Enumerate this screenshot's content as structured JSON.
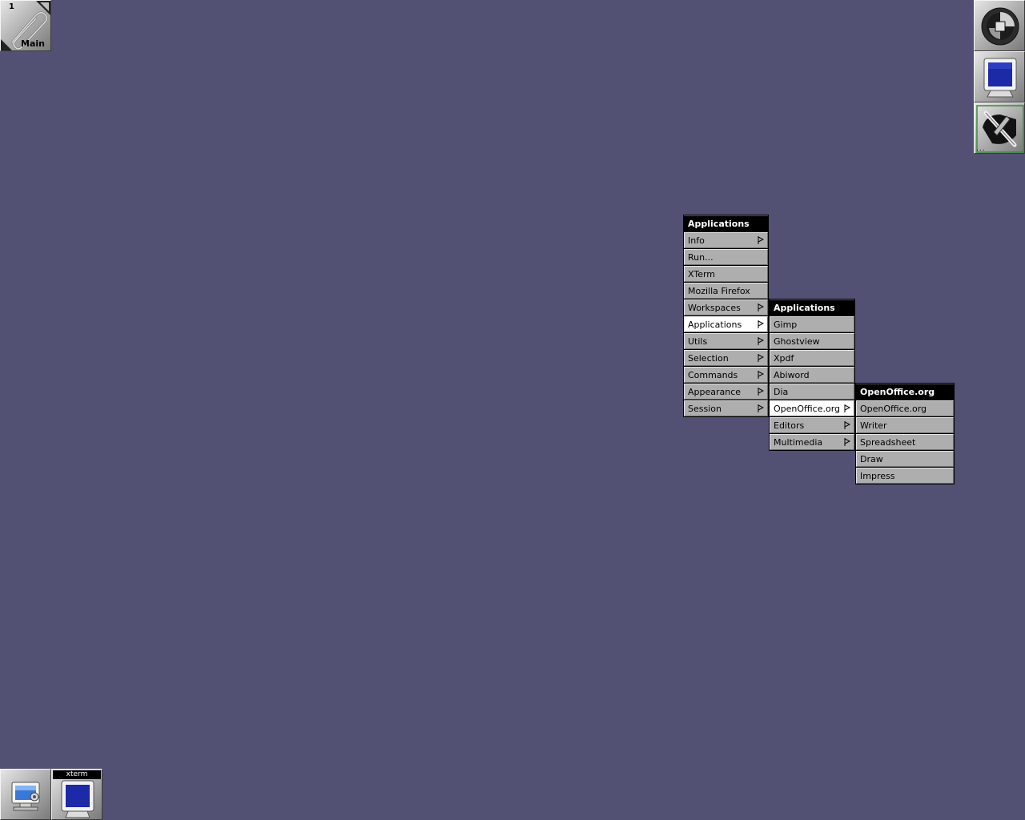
{
  "clip": {
    "workspace_number": "1",
    "workspace_name": "Main",
    "icon": "paperclip-icon"
  },
  "dock": [
    {
      "name": "window-maker-logo",
      "icon": "wmaker-logo-icon"
    },
    {
      "name": "terminal",
      "icon": "monitor-icon"
    },
    {
      "name": "preferences",
      "icon": "screwdriver-icon",
      "overflow": "..."
    }
  ],
  "miniwindows": [
    {
      "name": "desktop",
      "icon": "desktop-settings-icon"
    },
    {
      "name": "xterm",
      "title": "xterm",
      "icon": "monitor-icon"
    }
  ],
  "menus": {
    "main": {
      "title": "Applications",
      "items": [
        {
          "label": "Info",
          "submenu": true
        },
        {
          "label": "Run...",
          "submenu": false
        },
        {
          "label": "XTerm",
          "submenu": false
        },
        {
          "label": "Mozilla Firefox",
          "submenu": false
        },
        {
          "label": "Workspaces",
          "submenu": true
        },
        {
          "label": "Applications",
          "submenu": true,
          "active": true
        },
        {
          "label": "Utils",
          "submenu": true
        },
        {
          "label": "Selection",
          "submenu": true
        },
        {
          "label": "Commands",
          "submenu": true
        },
        {
          "label": "Appearance",
          "submenu": true
        },
        {
          "label": "Session",
          "submenu": true
        }
      ]
    },
    "applications": {
      "title": "Applications",
      "items": [
        {
          "label": "Gimp",
          "submenu": false
        },
        {
          "label": "Ghostview",
          "submenu": false
        },
        {
          "label": "Xpdf",
          "submenu": false
        },
        {
          "label": "Abiword",
          "submenu": false
        },
        {
          "label": "Dia",
          "submenu": false
        },
        {
          "label": "OpenOffice.org",
          "submenu": true,
          "active": true
        },
        {
          "label": "Editors",
          "submenu": true
        },
        {
          "label": "Multimedia",
          "submenu": true
        }
      ]
    },
    "openoffice": {
      "title": "OpenOffice.org",
      "items": [
        {
          "label": "OpenOffice.org",
          "submenu": false
        },
        {
          "label": "Writer",
          "submenu": false
        },
        {
          "label": "Spreadsheet",
          "submenu": false
        },
        {
          "label": "Draw",
          "submenu": false
        },
        {
          "label": "Impress",
          "submenu": false
        }
      ]
    }
  },
  "colors": {
    "desktop_background": "#525174",
    "menu_title_bg": "#000000",
    "menu_item_bg": "#aeaeae",
    "menu_item_active_bg": "#ffffff"
  }
}
